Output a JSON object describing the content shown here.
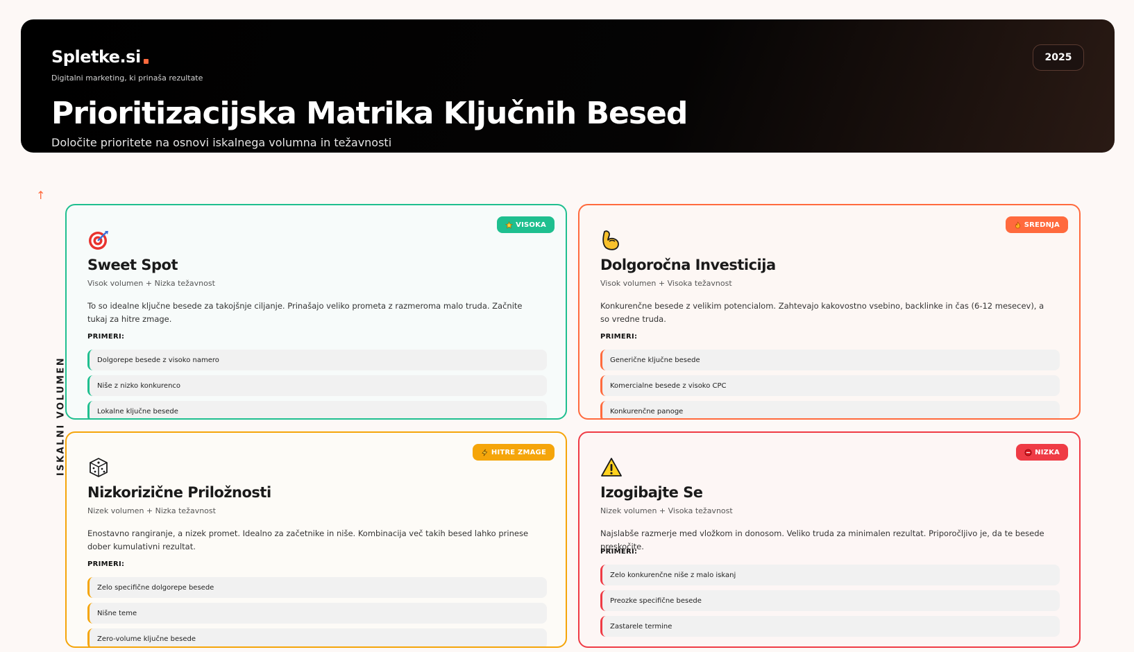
{
  "header": {
    "brand": "Spletke.si",
    "tagline": "Digitalni marketing, ki prinaša rezultate",
    "year": "2025",
    "title": "Prioritizacijska Matrika Ključnih Besed",
    "subtitle": "Določite prioritete na osnovi iskalnega volumna in težavnosti"
  },
  "axis": {
    "y_label": "ISKALNI VOLUMEN",
    "y_arrow": "↑"
  },
  "colors": {
    "green": "#1fbf8f",
    "orange": "#ff6a3d",
    "amber": "#f5a50a",
    "red": "#ef3b45"
  },
  "cards": [
    {
      "badge": "VISOKA",
      "badge_icon": "star-icon",
      "icon": "target-icon",
      "title": "Sweet Spot",
      "subtitle": "Visok volumen + Nizka težavnost",
      "description": "To so idealne ključne besede za takojšnje ciljanje. Prinašajo veliko prometa z razmeroma malo truda. Začnite tukaj za hitre zmage.",
      "examples_label": "PRIMERI:",
      "examples": [
        "Dolgorepe besede z visoko namero",
        "Niše z nizko konkurenco",
        "Lokalne ključne besede"
      ]
    },
    {
      "badge": "SREDNJA",
      "badge_icon": "fire-icon",
      "icon": "flexed-bicep-icon",
      "title": "Dolgoročna Investicija",
      "subtitle": "Visok volumen + Visoka težavnost",
      "description": "Konkurenčne besede z velikim potencialom. Zahtevajo kakovostno vsebino, backlinke in čas (6-12 mesecev), a so vredne truda.",
      "examples_label": "PRIMERI:",
      "examples": [
        "Generične ključne besede",
        "Komercialne besede z visoko CPC",
        "Konkurenčne panoge"
      ]
    },
    {
      "badge": "HITRE ZMAGE",
      "badge_icon": "lightning-icon",
      "icon": "dice-icon",
      "title": "Nizkorizične Priložnosti",
      "subtitle": "Nizek volumen + Nizka težavnost",
      "description": "Enostavno rangiranje, a nizek promet. Idealno za začetnike in niše. Kombinacija več takih besed lahko prinese dober kumulativni rezultat.",
      "examples_label": "PRIMERI:",
      "examples": [
        "Zelo specifične dolgorepe besede",
        "Nišne teme",
        "Zero-volume ključne besede"
      ]
    },
    {
      "badge": "NIZKA",
      "badge_icon": "no-entry-icon",
      "icon": "warning-icon",
      "title": "Izogibajte Se",
      "subtitle": "Nizek volumen + Visoka težavnost",
      "description": "Najslabše razmerje med vložkom in donosom. Veliko truda za minimalen rezultat. Priporočljivo je, da te besede preskočite.",
      "examples_label": "PRIMERI:",
      "examples": [
        "Zelo konkurenčne niše z malo iskanj",
        "Preozke specifične besede",
        "Zastarele termine"
      ]
    }
  ]
}
